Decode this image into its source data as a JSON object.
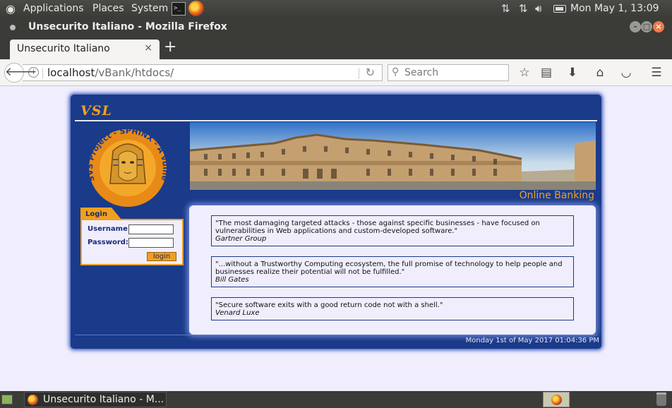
{
  "system_panel": {
    "menus": [
      "Applications",
      "Places",
      "System"
    ],
    "terminal_glyph": ">_",
    "datetime": "Mon May  1, 13:09"
  },
  "window": {
    "title": "Unsecurito Italiano - Mozilla Firefox"
  },
  "tab": {
    "label": "Unsecurito Italiano",
    "close": "×",
    "new": "+"
  },
  "navbar": {
    "url_host": "localhost",
    "url_path": "/vBank/htdocs/",
    "search_placeholder": "Search"
  },
  "page": {
    "logo_text": "VSL",
    "banner_caption": "Online Banking",
    "sphinx_ring_text": "SVS Project - SPHINX - A vulnerable Web App -",
    "login": {
      "header": "Login",
      "username_label": "Username:",
      "password_label": "Password:",
      "button": "login"
    },
    "quotes": [
      {
        "text": "\"The most damaging targeted attacks - those against specific businesses - have focused on vulnerabilities in Web applications and custom-developed software.\"",
        "author": "Gartner Group"
      },
      {
        "text": "\"...without a Trustworthy Computing ecosystem, the full promise of technology to help people and businesses realize their potential will not be fulfilled.\"",
        "author": "Bill Gates"
      },
      {
        "text": "\"Secure software exits with a good return code not with a shell.\"",
        "author": "Venard Luxe"
      }
    ],
    "footer_datetime": "Monday 1st of May 2017 01:04:36 PM"
  },
  "taskbar": {
    "task_label": "Unsecurito Italiano - M..."
  },
  "colors": {
    "frame_blue": "#1a3a8a",
    "accent_orange": "#f0a020",
    "page_background": "#f0eefc"
  }
}
